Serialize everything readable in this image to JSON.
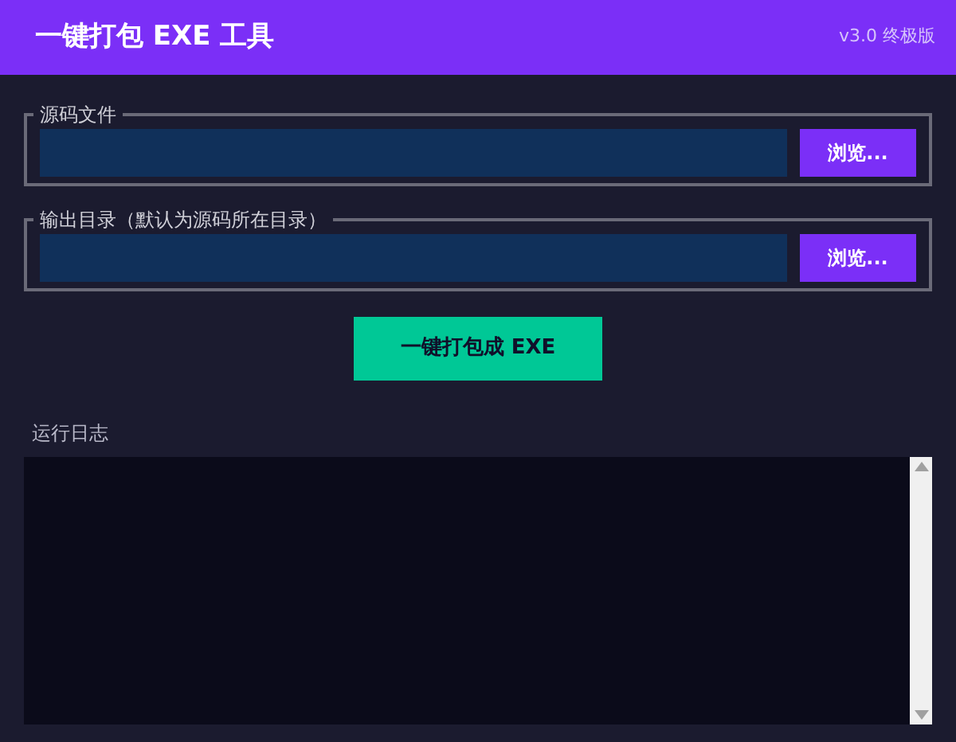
{
  "header": {
    "title": "一键打包 EXE 工具",
    "version": "v3.0 终极版"
  },
  "groups": [
    {
      "legend": "源码文件",
      "button": "浏览..."
    },
    {
      "legend": "输出目录（默认为源码所在目录）",
      "button": "浏览..."
    }
  ],
  "action_button": "一键打包成 EXE",
  "log": {
    "label": "运行日志"
  }
}
